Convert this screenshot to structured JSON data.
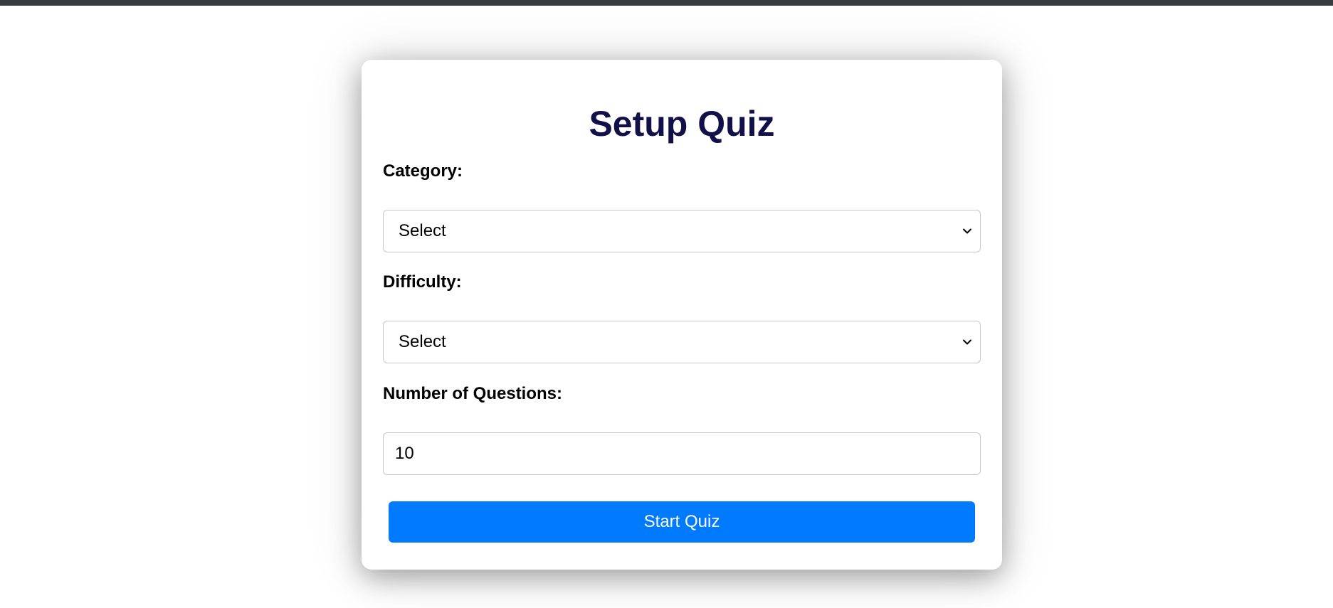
{
  "quiz_setup": {
    "title": "Setup Quiz",
    "category": {
      "label": "Category:",
      "selected": "Select"
    },
    "difficulty": {
      "label": "Difficulty:",
      "selected": "Select"
    },
    "num_questions": {
      "label": "Number of Questions:",
      "value": "10"
    },
    "start_button_label": "Start Quiz"
  },
  "colors": {
    "title": "#121049",
    "button": "#007bff",
    "top_bar": "#3a3b42"
  }
}
